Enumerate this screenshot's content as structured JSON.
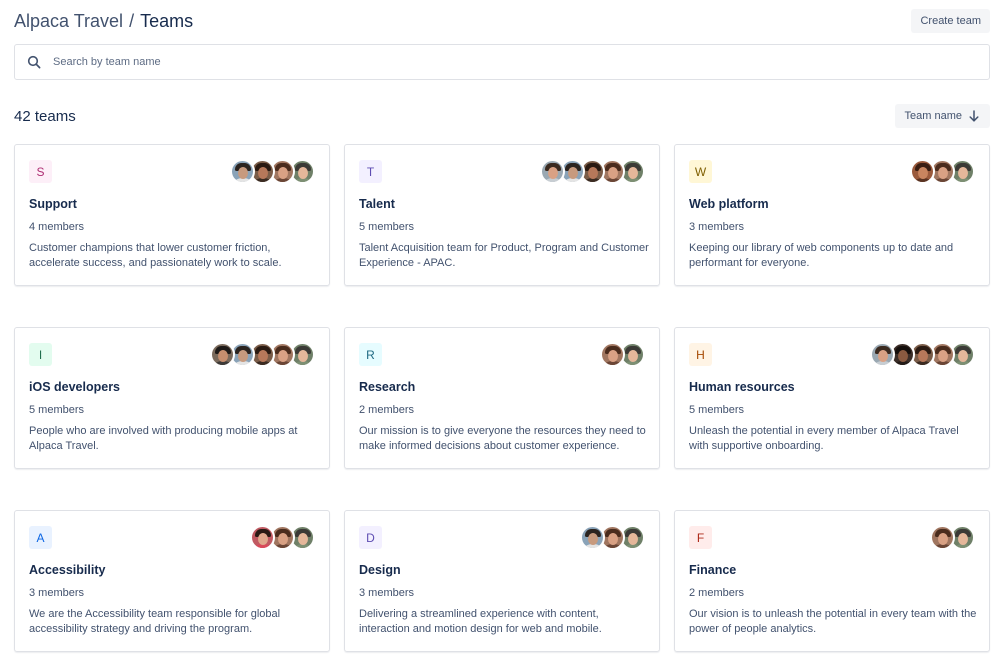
{
  "breadcrumb": {
    "parent": "Alpaca Travel",
    "separator": "/",
    "current": "Teams"
  },
  "actions": {
    "create_label": "Create team",
    "sort_label": "Team name"
  },
  "search": {
    "placeholder": "Search by team name",
    "value": ""
  },
  "summary": {
    "count_label": "42 teams"
  },
  "colors": {
    "border": "#dfe1e6",
    "text": "#172b4d",
    "subtle": "#42526e",
    "button_bg": "#f4f5f7"
  },
  "teams": [
    {
      "letter": "S",
      "name": "Support",
      "members": "4 members",
      "description": "Customer champions that lower customer friction, accelerate success, and passionately work to scale.",
      "badge_bg": "#fdeff8",
      "badge_fg": "#ae2e73",
      "avatars": [
        {
          "bg": "#8aa3b8",
          "skin": "#c79a7e",
          "hair": "#2b2420",
          "shirt": "#e4e4e4"
        },
        {
          "bg": "#7a5c48",
          "skin": "#b7785a",
          "hair": "#2a1a12",
          "shirt": "#3b2b22"
        },
        {
          "bg": "#a07660",
          "skin": "#d9a184",
          "hair": "#4a2c1d",
          "shirt": "#6b4636"
        },
        {
          "bg": "#6f8068",
          "skin": "#e5b79a",
          "hair": "#3b3a36",
          "shirt": "#7d8f73"
        }
      ]
    },
    {
      "letter": "T",
      "name": "Talent",
      "members": "5 members",
      "description": "Talent Acquisition team for Product, Program and Customer Experience - APAC.",
      "badge_bg": "#f3f0ff",
      "badge_fg": "#5e4db2",
      "avatars": [
        {
          "bg": "#9aa8b2",
          "skin": "#d9a184",
          "hair": "#3a2a20",
          "shirt": "#c7cdd2"
        },
        {
          "bg": "#8aa3b8",
          "skin": "#c79a7e",
          "hair": "#2b2420",
          "shirt": "#e4e4e4"
        },
        {
          "bg": "#7a5c48",
          "skin": "#b7785a",
          "hair": "#2a1a12",
          "shirt": "#3b2b22"
        },
        {
          "bg": "#a07660",
          "skin": "#d9a184",
          "hair": "#4a2c1d",
          "shirt": "#6b4636"
        },
        {
          "bg": "#6f8068",
          "skin": "#e5b79a",
          "hair": "#3b3a36",
          "shirt": "#7d8f73"
        }
      ]
    },
    {
      "letter": "W",
      "name": "Web platform",
      "members": "3 members",
      "description": "Keeping our library of web components up to date and performant for everyone.",
      "badge_bg": "#fff7d6",
      "badge_fg": "#7f5f01",
      "avatars": [
        {
          "bg": "#9a5a3c",
          "skin": "#c9855f",
          "hair": "#3a1e12",
          "shirt": "#5a3322"
        },
        {
          "bg": "#a07660",
          "skin": "#d9a184",
          "hair": "#4a2c1d",
          "shirt": "#6b4636"
        },
        {
          "bg": "#6f8068",
          "skin": "#e5b79a",
          "hair": "#3b3a36",
          "shirt": "#7d8f73"
        }
      ]
    },
    {
      "letter": "I",
      "name": "iOS developers",
      "members": "5 members",
      "description": "People who are involved with producing mobile apps at Alpaca Travel.",
      "badge_bg": "#e3fcef",
      "badge_fg": "#216e4e",
      "avatars": [
        {
          "bg": "#7a6a5c",
          "skin": "#c68e6e",
          "hair": "#1e1a18",
          "shirt": "#3d3a38"
        },
        {
          "bg": "#8aa3b8",
          "skin": "#c79a7e",
          "hair": "#2b2420",
          "shirt": "#e4e4e4"
        },
        {
          "bg": "#7a5c48",
          "skin": "#b7785a",
          "hair": "#2a1a12",
          "shirt": "#3b2b22"
        },
        {
          "bg": "#a07660",
          "skin": "#d9a184",
          "hair": "#4a2c1d",
          "shirt": "#6b4636"
        },
        {
          "bg": "#6f8068",
          "skin": "#e5b79a",
          "hair": "#3b3a36",
          "shirt": "#7d8f73"
        }
      ]
    },
    {
      "letter": "R",
      "name": "Research",
      "members": "2 members",
      "description": "Our mission is to give everyone the resources they need to make informed decisions about customer experience.",
      "badge_bg": "#e6fcff",
      "badge_fg": "#206a83",
      "avatars": [
        {
          "bg": "#a07660",
          "skin": "#d9a184",
          "hair": "#4a2c1d",
          "shirt": "#6b4636"
        },
        {
          "bg": "#6f8068",
          "skin": "#e5b79a",
          "hair": "#3b3a36",
          "shirt": "#7d8f73"
        }
      ]
    },
    {
      "letter": "H",
      "name": "Human resources",
      "members": "5 members",
      "description": "Unleash the potential in every member of Alpaca Travel with supportive onboarding.",
      "badge_bg": "#fff4e5",
      "badge_fg": "#a54800",
      "avatars": [
        {
          "bg": "#9aa8b2",
          "skin": "#d9a184",
          "hair": "#3a2a20",
          "shirt": "#c7cdd2"
        },
        {
          "bg": "#3b2e28",
          "skin": "#8a5a40",
          "hair": "#140e0b",
          "shirt": "#241b17"
        },
        {
          "bg": "#7a5c48",
          "skin": "#b7785a",
          "hair": "#2a1a12",
          "shirt": "#3b2b22"
        },
        {
          "bg": "#a07660",
          "skin": "#d9a184",
          "hair": "#4a2c1d",
          "shirt": "#6b4636"
        },
        {
          "bg": "#6f8068",
          "skin": "#e5b79a",
          "hair": "#3b3a36",
          "shirt": "#7d8f73"
        }
      ]
    },
    {
      "letter": "A",
      "name": "Accessibility",
      "members": "3 members",
      "description": "We are the Accessibility team responsible for global accessibility strategy and driving the program.",
      "badge_bg": "#e9f2ff",
      "badge_fg": "#0c66e4",
      "avatars": [
        {
          "bg": "#c05a62",
          "skin": "#e0a88c",
          "hair": "#2a1a14",
          "shirt": "#d94a5a"
        },
        {
          "bg": "#a07660",
          "skin": "#d9a184",
          "hair": "#4a2c1d",
          "shirt": "#6b4636"
        },
        {
          "bg": "#6f8068",
          "skin": "#e5b79a",
          "hair": "#3b3a36",
          "shirt": "#7d8f73"
        }
      ]
    },
    {
      "letter": "D",
      "name": "Design",
      "members": "3 members",
      "description": "Delivering a streamlined experience with content, interaction and motion design for web and mobile.",
      "badge_bg": "#f3f0ff",
      "badge_fg": "#5e4db2",
      "avatars": [
        {
          "bg": "#8aa3b8",
          "skin": "#c79a7e",
          "hair": "#2b2420",
          "shirt": "#e4e4e4"
        },
        {
          "bg": "#a07660",
          "skin": "#d9a184",
          "hair": "#4a2c1d",
          "shirt": "#6b4636"
        },
        {
          "bg": "#6f8068",
          "skin": "#e5b79a",
          "hair": "#3b3a36",
          "shirt": "#7d8f73"
        }
      ]
    },
    {
      "letter": "F",
      "name": "Finance",
      "members": "2 members",
      "description": "Our vision is to unleash the potential in every team with the power of people analytics.",
      "badge_bg": "#ffeceb",
      "badge_fg": "#ae2a19",
      "avatars": [
        {
          "bg": "#a07660",
          "skin": "#d9a184",
          "hair": "#4a2c1d",
          "shirt": "#6b4636"
        },
        {
          "bg": "#6f8068",
          "skin": "#e5b79a",
          "hair": "#3b3a36",
          "shirt": "#7d8f73"
        }
      ]
    }
  ]
}
